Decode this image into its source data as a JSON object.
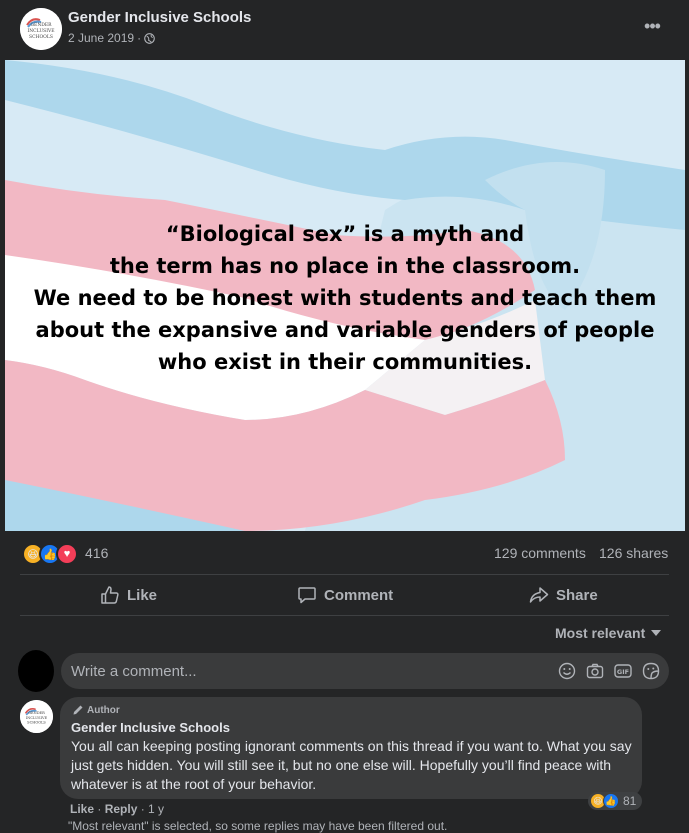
{
  "post": {
    "page_name": "Gender Inclusive Schools",
    "date": "2 June 2019",
    "separator": "·",
    "avatar_text": "GENDER INCLUSIVE SCHOOLS",
    "quote_lines": [
      "“Biological sex” is a myth and",
      "the term has no place in the classroom.",
      "We need to be honest with students and teach them",
      "about the expansive and variable genders of people",
      "who exist in their communities."
    ]
  },
  "engagement": {
    "reactions_count": "416",
    "comments": "129 comments",
    "shares": "126 shares",
    "reaction_types": [
      "haha",
      "like",
      "love"
    ]
  },
  "actions": {
    "like": "Like",
    "comment": "Comment",
    "share": "Share"
  },
  "comments_section": {
    "sort_label": "Most relevant",
    "input_placeholder": "Write a comment...",
    "input_icons": [
      "emoji-icon",
      "camera-icon",
      "gif-icon",
      "sticker-icon"
    ],
    "gif_label": "GIF"
  },
  "comment": {
    "badge": "Author",
    "author": "Gender Inclusive Schools",
    "text": "You all can keeping posting ignorant comments on this thread if you want to. What you say just gets hidden. You will still see it, but no one else will. Hopefully you’ll find peace with whatever is at the root of your behavior.",
    "reaction_count": "81",
    "like": "Like",
    "reply": "Reply",
    "age": "1 y",
    "filter_note": "\"Most relevant\" is selected, so some replies may have been filtered out."
  },
  "colors": {
    "background": "#242526",
    "bubble": "#3a3b3c",
    "flag_blue": "#a9d7ee",
    "flag_pink": "#f2b6c3",
    "flag_white": "#ffffff"
  }
}
